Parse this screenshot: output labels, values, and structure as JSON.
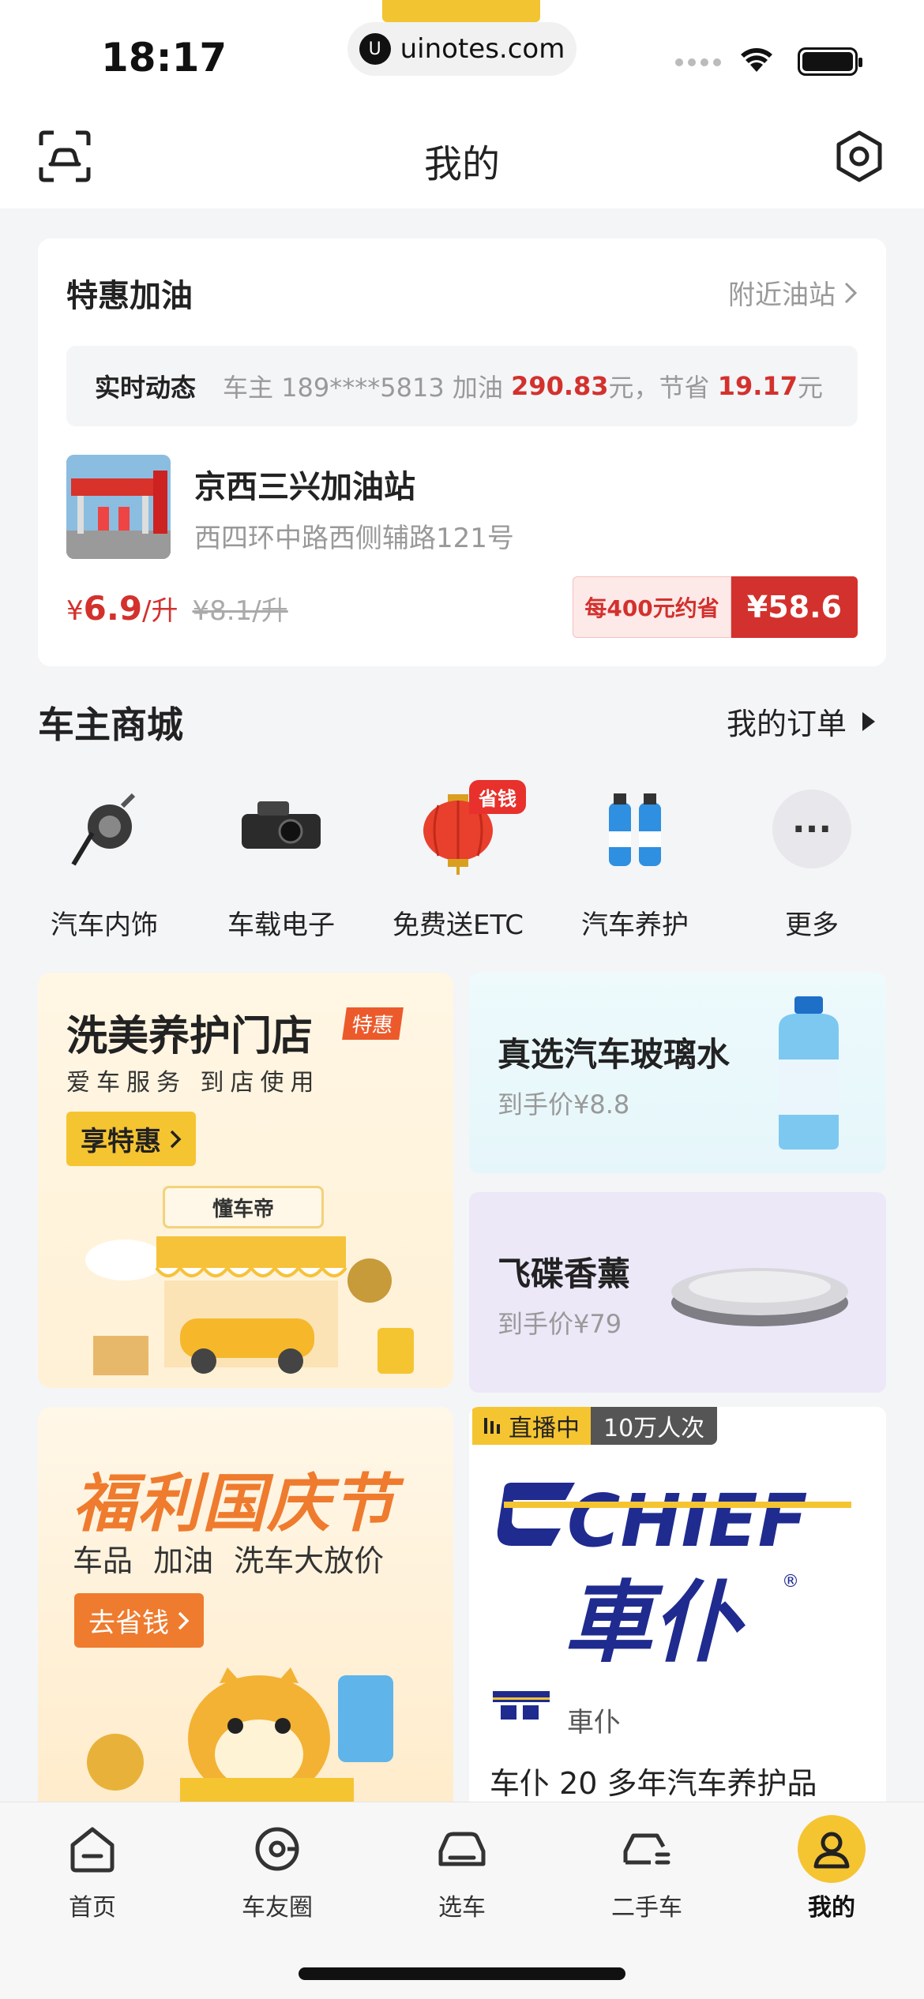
{
  "status_bar": {
    "time": "18:17",
    "url": "uinotes.com"
  },
  "nav": {
    "title": "我的"
  },
  "fuel": {
    "title": "特惠加油",
    "nearby_label": "附近油站",
    "live_label": "实时动态",
    "live_text_prefix": "车主 189****5813 加油",
    "live_amount": "290.83",
    "live_text_mid": "元，节省",
    "live_saving": "19.17",
    "live_text_suffix": "元",
    "station_name": "京西三兴加油站",
    "station_address": "西四环中路西侧辅路121号",
    "price_symbol": "¥",
    "price_value": "6.9",
    "price_unit": "/升",
    "price_old": "¥8.1/升",
    "save_label": "每400元约省",
    "save_value": "¥58.6"
  },
  "mall": {
    "title": "车主商城",
    "orders_label": "我的订单",
    "categories": [
      {
        "label": "汽车内饰",
        "icon": "air-vent-clip-icon"
      },
      {
        "label": "车载电子",
        "icon": "dashcam-icon"
      },
      {
        "label": "免费送ETC",
        "icon": "lantern-icon",
        "badge": "省钱"
      },
      {
        "label": "汽车养护",
        "icon": "washer-fluid-icon"
      },
      {
        "label": "更多",
        "icon": "more-icon",
        "more_glyph": "···"
      }
    ]
  },
  "promos": {
    "wash": {
      "title": "洗美养护门店",
      "tag": "特惠",
      "subtitle": "爱车服务 到店使用",
      "button": "享特惠",
      "brand": "懂车帝"
    },
    "glass": {
      "title": "真选汽车玻璃水",
      "price": "到手价¥8.8"
    },
    "disc": {
      "title": "飞碟香薰",
      "price": "到手价¥79"
    },
    "guoqing": {
      "title": "福利国庆节",
      "subtitle": "车品 加油 洗车大放价",
      "button": "去省钱"
    },
    "live": {
      "status": "直播中",
      "viewers": "10万人次",
      "logo_en": "CHIEF",
      "logo_cn": "車仆",
      "brand": "車仆",
      "description": "车仆 20 多年汽车养护品"
    }
  },
  "tabbar": {
    "items": [
      {
        "label": "首页"
      },
      {
        "label": "车友圈"
      },
      {
        "label": "选车"
      },
      {
        "label": "二手车"
      },
      {
        "label": "我的"
      }
    ]
  },
  "colors": {
    "accent_yellow": "#f5c431",
    "price_red": "#d3312d",
    "promo_orange": "#ef7b2e",
    "brand_blue": "#1f2b8f"
  }
}
